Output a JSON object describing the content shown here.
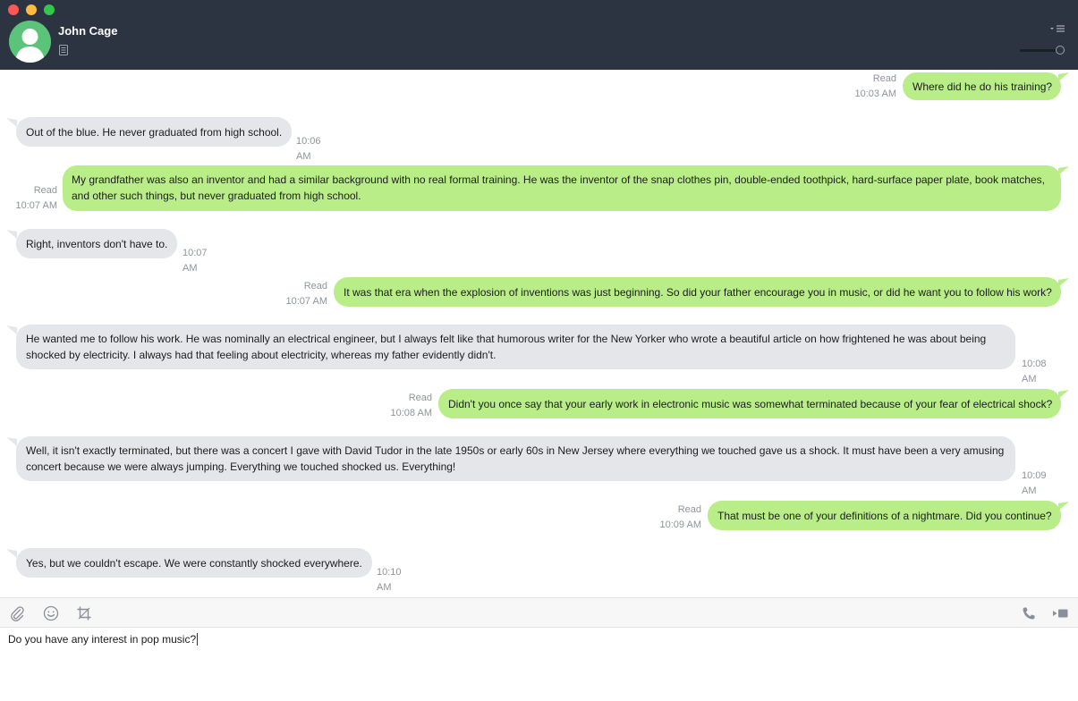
{
  "header": {
    "contact_name": "John Cage"
  },
  "messages": [
    {
      "direction": "out",
      "text": "Where did he do his training?",
      "status": "Read",
      "time": "10:03 AM"
    },
    {
      "direction": "in",
      "text": "Out of the blue. He never graduated from high school.",
      "time": "10:06 AM"
    },
    {
      "direction": "out",
      "text": "My grandfather was also an inventor and had a similar background with no real formal training. He was the inventor of the snap clothes pin, double-ended toothpick, hard-surface paper plate, book matches, and other such things, but never graduated from high school.",
      "status": "Read",
      "time": "10:07 AM"
    },
    {
      "direction": "in",
      "text": "Right, inventors don't have to.",
      "time": "10:07 AM"
    },
    {
      "direction": "out",
      "text": "It was that era when the explosion of inventions was just beginning. So did your father encourage you in music, or did he want you to follow his work?",
      "status": "Read",
      "time": "10:07 AM"
    },
    {
      "direction": "in",
      "text": "He wanted me to follow his work. He was nominally an electrical engineer, but I always felt like that humorous writer for the New Yorker who wrote a beautiful article on how frightened he was about being shocked by electricity. I always had that feeling about electricity, whereas my father evidently didn't.",
      "time": "10:08 AM"
    },
    {
      "direction": "out",
      "text": "Didn't you once say that your early work in electronic music was somewhat terminated because of your fear of electrical shock?",
      "status": "Read",
      "time": "10:08 AM"
    },
    {
      "direction": "in",
      "text": "Well, it isn't exactly terminated, but there was a concert I gave with David Tudor in the late 1950s or early 60s in New Jersey where everything we touched gave us a shock. It must have been a very amusing concert because we were always jumping. Everything we touched shocked us. Everything!",
      "time": "10:09 AM"
    },
    {
      "direction": "out",
      "text": "That must be one of your definitions of a nightmare. Did you continue?",
      "status": "Read",
      "time": "10:09 AM"
    },
    {
      "direction": "in",
      "text": "Yes, but we couldn't escape. We were constantly shocked everywhere.",
      "time": "10:10 AM"
    }
  ],
  "composer": {
    "draft": "Do you have any interest in pop music?"
  }
}
